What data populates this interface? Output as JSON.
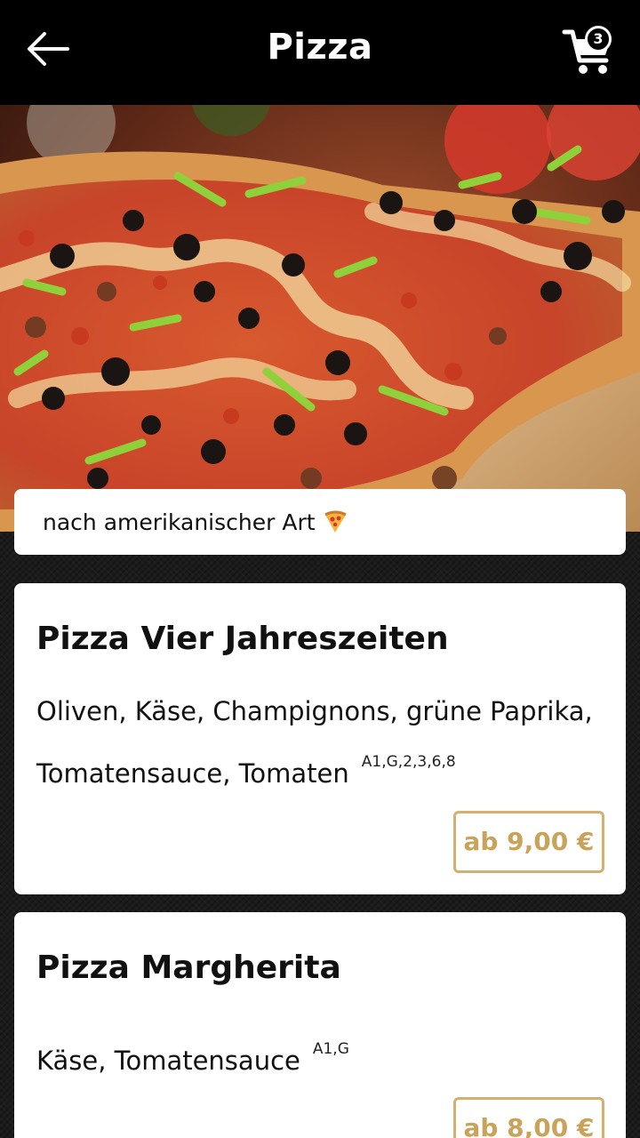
{
  "header": {
    "title": "Pizza",
    "cart_count": "3"
  },
  "category": {
    "subtitle": "nach amerikanischer Art"
  },
  "items": [
    {
      "name": "Pizza Vier Jahreszeiten",
      "desc_line1": "Oliven, Käse, Champignons, grüne Paprika,",
      "desc_line2": "Tomatensauce, Tomaten",
      "allergens": "A1,G,2,3,6,8",
      "price": "ab 9,00 €"
    },
    {
      "name": "Pizza Margherita",
      "desc_line1": "Käse, Tomatensauce",
      "allergens": "A1,G",
      "price": "ab 8,00 €"
    }
  ],
  "colors": {
    "header_bg": "#000000",
    "price_accent": "#c9a35a",
    "card_bg": "#ffffff"
  },
  "icons": [
    "back-arrow-icon",
    "cart-icon",
    "pizza-slice-icon"
  ]
}
